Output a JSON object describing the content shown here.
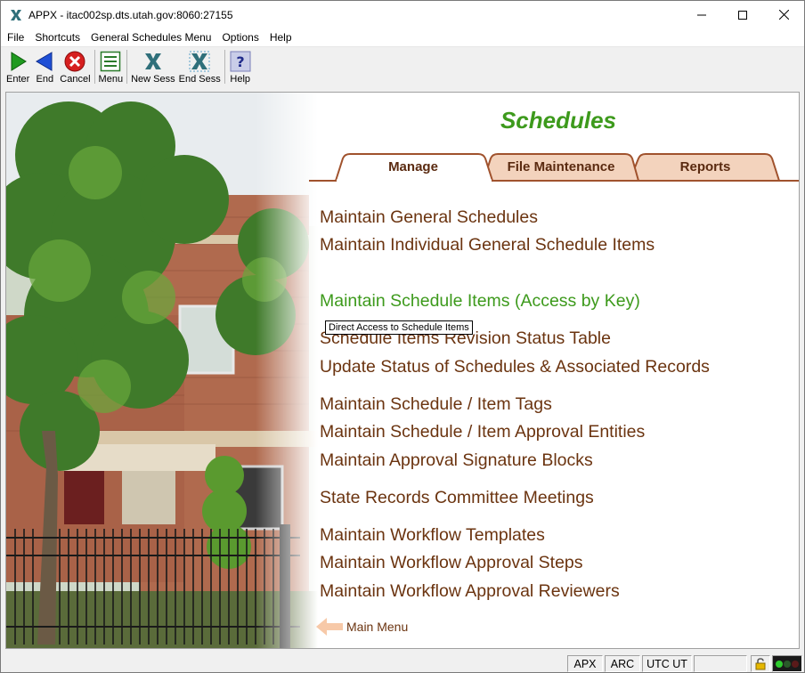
{
  "window": {
    "title": "APPX - itac002sp.dts.utah.gov:8060:27155",
    "icon": "appx-x-icon"
  },
  "menubar": {
    "items": [
      "File",
      "Shortcuts",
      "General Schedules Menu",
      "Options",
      "Help"
    ]
  },
  "toolbar": {
    "buttons": [
      {
        "label": "Enter",
        "icon": "play-arrow-icon"
      },
      {
        "label": "End",
        "icon": "back-arrow-icon"
      },
      {
        "label": "Cancel",
        "icon": "cancel-x-icon"
      },
      {
        "label": "Menu",
        "icon": "menu-list-icon"
      },
      {
        "label": "New Sess",
        "icon": "new-session-icon"
      },
      {
        "label": "End Sess",
        "icon": "end-session-icon"
      },
      {
        "label": "Help",
        "icon": "help-question-icon"
      }
    ]
  },
  "page": {
    "heading": "Schedules",
    "tabs": [
      "Manage",
      "File Maintenance",
      "Reports"
    ],
    "active_tab": "Manage",
    "links": [
      "Maintain General Schedules",
      "Maintain Individual General Schedule Items",
      "Maintain Schedule Items (Access by Key)",
      "Schedule Items Revision Status Table",
      "Update Status of Schedules & Associated Records",
      "Maintain Schedule / Item Tags",
      "Maintain Schedule / Item Approval Entities",
      "Maintain Approval Signature Blocks",
      "State Records Committee Meetings",
      "Maintain Workflow Templates",
      "Maintain Workflow Approval Steps",
      "Maintain Workflow Approval Reviewers"
    ],
    "hovered_link": "Maintain Schedule Items (Access by Key)",
    "tooltip": "Direct Access to Schedule Items",
    "main_menu_label": "Main Menu"
  },
  "statusbar": {
    "cells": [
      "APX",
      "ARC",
      "UTC UT"
    ]
  },
  "colors": {
    "heading": "#3d9a1c",
    "link": "#6b3410",
    "link_hover": "#3d9a1c",
    "tab_fill": "#f3d3bd",
    "tab_border": "#a0522d"
  }
}
